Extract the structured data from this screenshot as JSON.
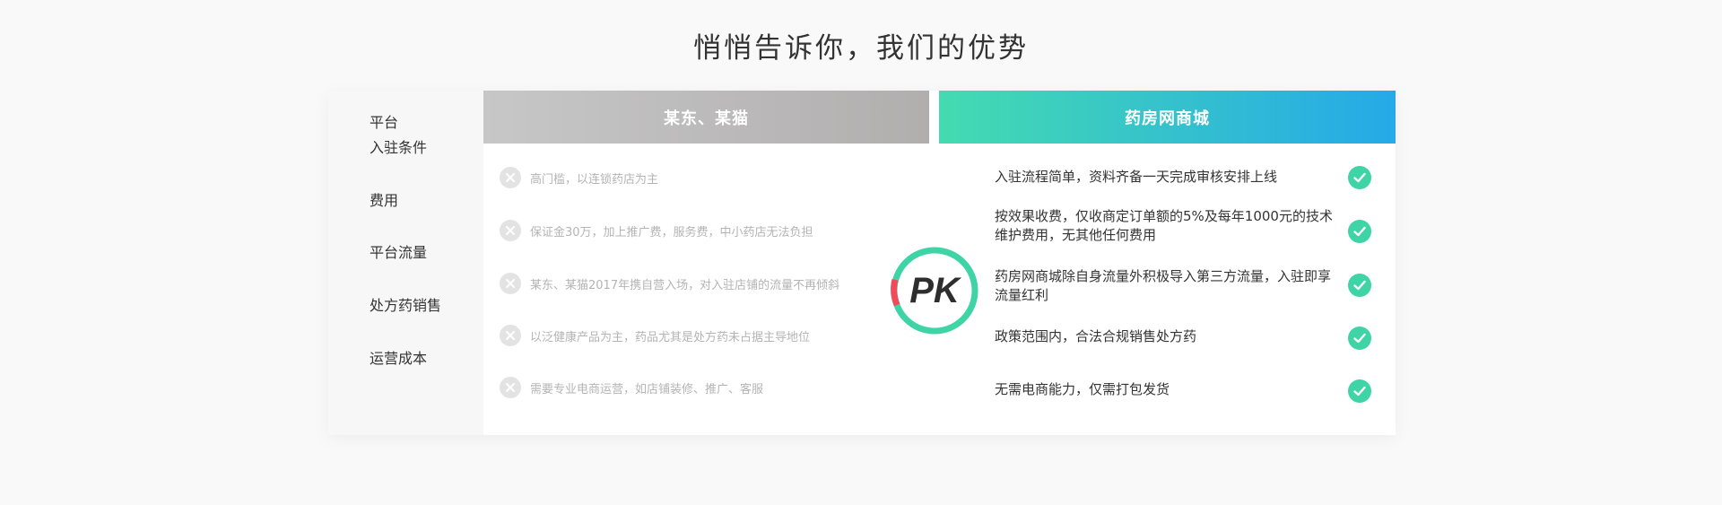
{
  "title": "悄悄告诉你，我们的优势",
  "rows": {
    "header_label": "平台",
    "labels": [
      "入驻条件",
      "费用",
      "平台流量",
      "处方药销售",
      "运营成本"
    ]
  },
  "competitor": {
    "name": "某东、某猫",
    "items": [
      "高门槛，以连锁药店为主",
      "保证金30万，加上推广费，服务费，中小药店无法负担",
      "某东、某猫2017年携自营入场，对入驻店铺的流量不再倾斜",
      "以泛健康产品为主，药品尤其是处方药未占据主导地位",
      "需要专业电商运营，如店铺装修、推广、客服"
    ]
  },
  "ours": {
    "name": "药房网商城",
    "items": [
      "入驻流程简单，资料齐备一天完成审核安排上线",
      "按效果收费，仅收商定订单额的5%及每年1000元的技术维护费用，无其他任何费用",
      "药房网商城除自身流量外积极导入第三方流量，入驻即享流量红利",
      "政策范围内，合法合规销售处方药",
      "无需电商能力，仅需打包发货"
    ]
  },
  "badge": {
    "text": "PK"
  },
  "colors": {
    "accent_green": "#3fd4a6",
    "accent_blue": "#26a9e8",
    "pk_red": "#f24a5a",
    "gray_header": "#bcbcbc"
  },
  "icons": {
    "negative": "x-icon",
    "positive": "check-icon"
  }
}
